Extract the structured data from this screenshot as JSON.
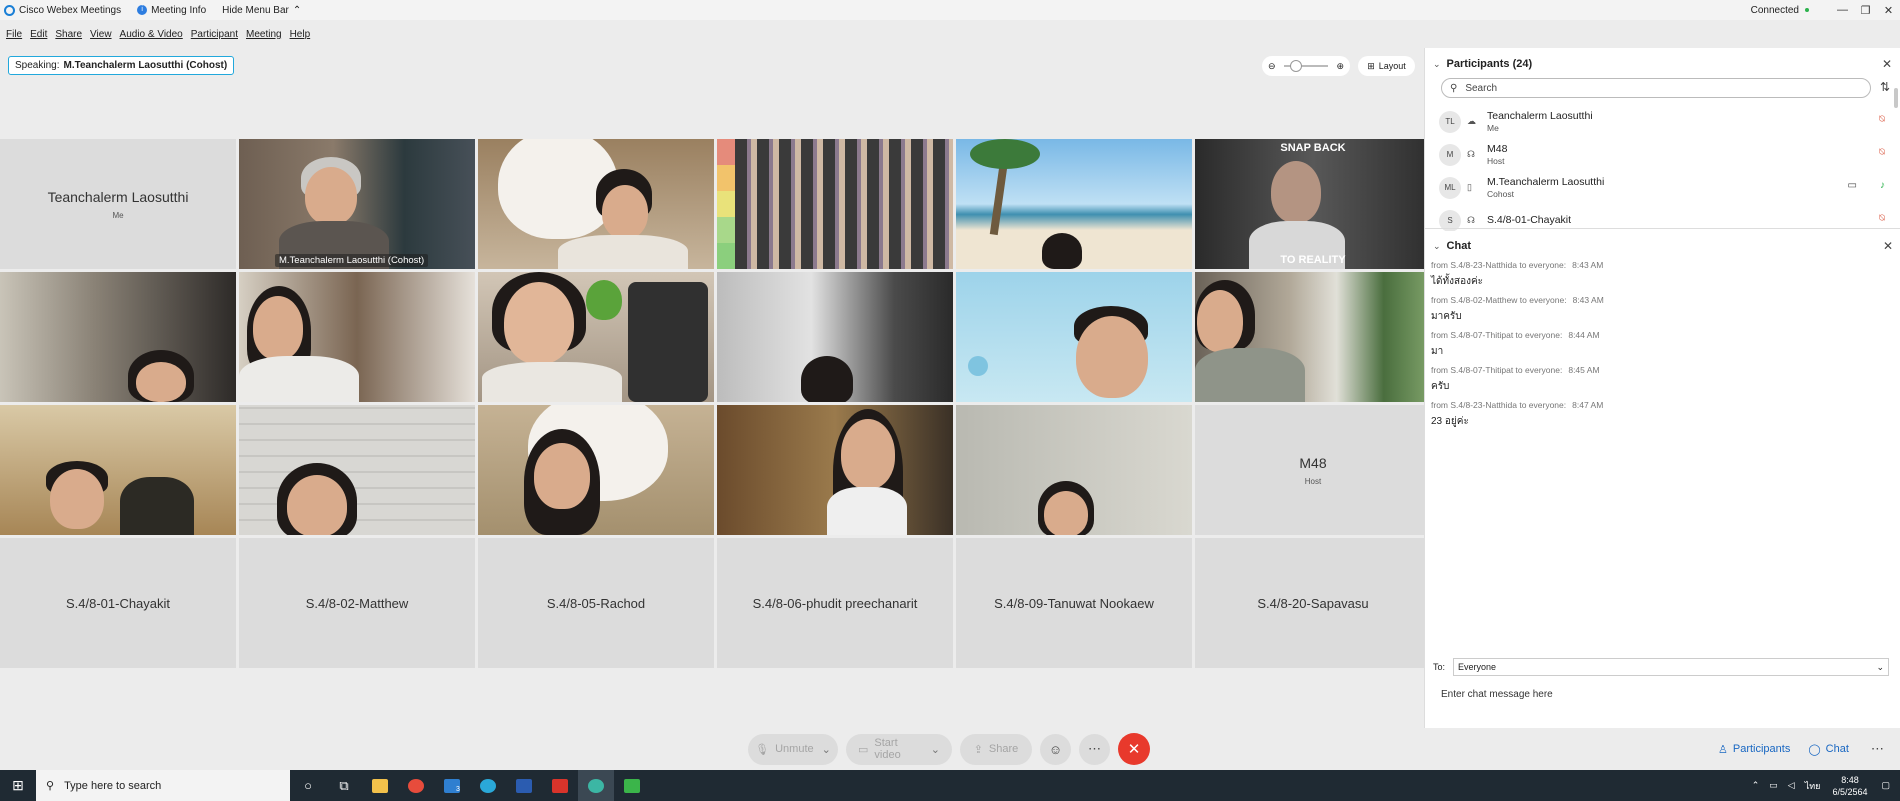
{
  "window": {
    "app_title": "Cisco Webex Meetings",
    "meeting_info": "Meeting Info",
    "hide_menu": "Hide Menu Bar",
    "status": "Connected",
    "min": "—",
    "max": "❐",
    "close": "✕"
  },
  "menu": [
    "File",
    "Edit",
    "Share",
    "View",
    "Audio & Video",
    "Participant",
    "Meeting",
    "Help"
  ],
  "speaking": {
    "label": "Speaking:",
    "name": "M.Teanchalerm Laosutthi (Cohost)"
  },
  "zoom": {
    "minus": "⊖",
    "plus": "⊕"
  },
  "layout_label": "Layout",
  "tiles": {
    "t1": {
      "name": "Teanchalerm Laosutthi",
      "sub": "Me"
    },
    "t2": {
      "badge": "M.Teanchalerm Laosutthi (Cohost)"
    },
    "t6": {
      "top": "SNAP BACK",
      "bottom": "TO REALITY"
    },
    "t18": {
      "name": "M48",
      "sub": "Host"
    },
    "t19": {
      "name": "S.4/8-01-Chayakit"
    },
    "t20": {
      "name": "S.4/8-02-Matthew"
    },
    "t21": {
      "name": "S.4/8-05-Rachod"
    },
    "t22": {
      "name": "S.4/8-06-phudit preechanarit"
    },
    "t23": {
      "name": "S.4/8-09-Tanuwat Nookaew"
    },
    "t24": {
      "name": "S.4/8-20-Sapavasu"
    }
  },
  "controls": {
    "unmute": "Unmute",
    "start_video": "Start video",
    "share": "Share"
  },
  "participants": {
    "title": "Participants (24)",
    "search_placeholder": "Search",
    "list": [
      {
        "initials": "TL",
        "name": "Teanchalerm Laosutthi",
        "role": "Me"
      },
      {
        "initials": "M",
        "name": "M48",
        "role": "Host"
      },
      {
        "initials": "ML",
        "name": "M.Teanchalerm Laosutthi",
        "role": "Cohost"
      },
      {
        "initials": "S",
        "name": "S.4/8-01-Chayakit",
        "role": ""
      }
    ]
  },
  "chat": {
    "title": "Chat",
    "messages": [
      {
        "from": "from S.4/8-23-Natthida to everyone:",
        "time": "8:43 AM",
        "text": "ได้ทั้งสองค่ะ"
      },
      {
        "from": "from S.4/8-02-Matthew to everyone:",
        "time": "8:43 AM",
        "text": "มาครับ"
      },
      {
        "from": "from S.4/8-07-Thitipat to everyone:",
        "time": "8:44 AM",
        "text": "มา"
      },
      {
        "from": "from S.4/8-07-Thitipat to everyone:",
        "time": "8:45 AM",
        "text": "ครับ"
      },
      {
        "from": "from S.4/8-23-Natthida to everyone:",
        "time": "8:47 AM",
        "text": "23 อยู่ค่ะ"
      }
    ],
    "to_label": "To:",
    "to_value": "Everyone",
    "input_placeholder": "Enter chat message here"
  },
  "panel_tabs": {
    "participants": "Participants",
    "chat": "Chat"
  },
  "taskbar": {
    "search_placeholder": "Type here to search",
    "lang": "ไทย",
    "time": "8:48",
    "date": "6/5/2564",
    "mail_badge": "3"
  },
  "colors": {
    "accent": "#21a8dc",
    "end_call": "#e8392c",
    "link": "#1967c2"
  }
}
